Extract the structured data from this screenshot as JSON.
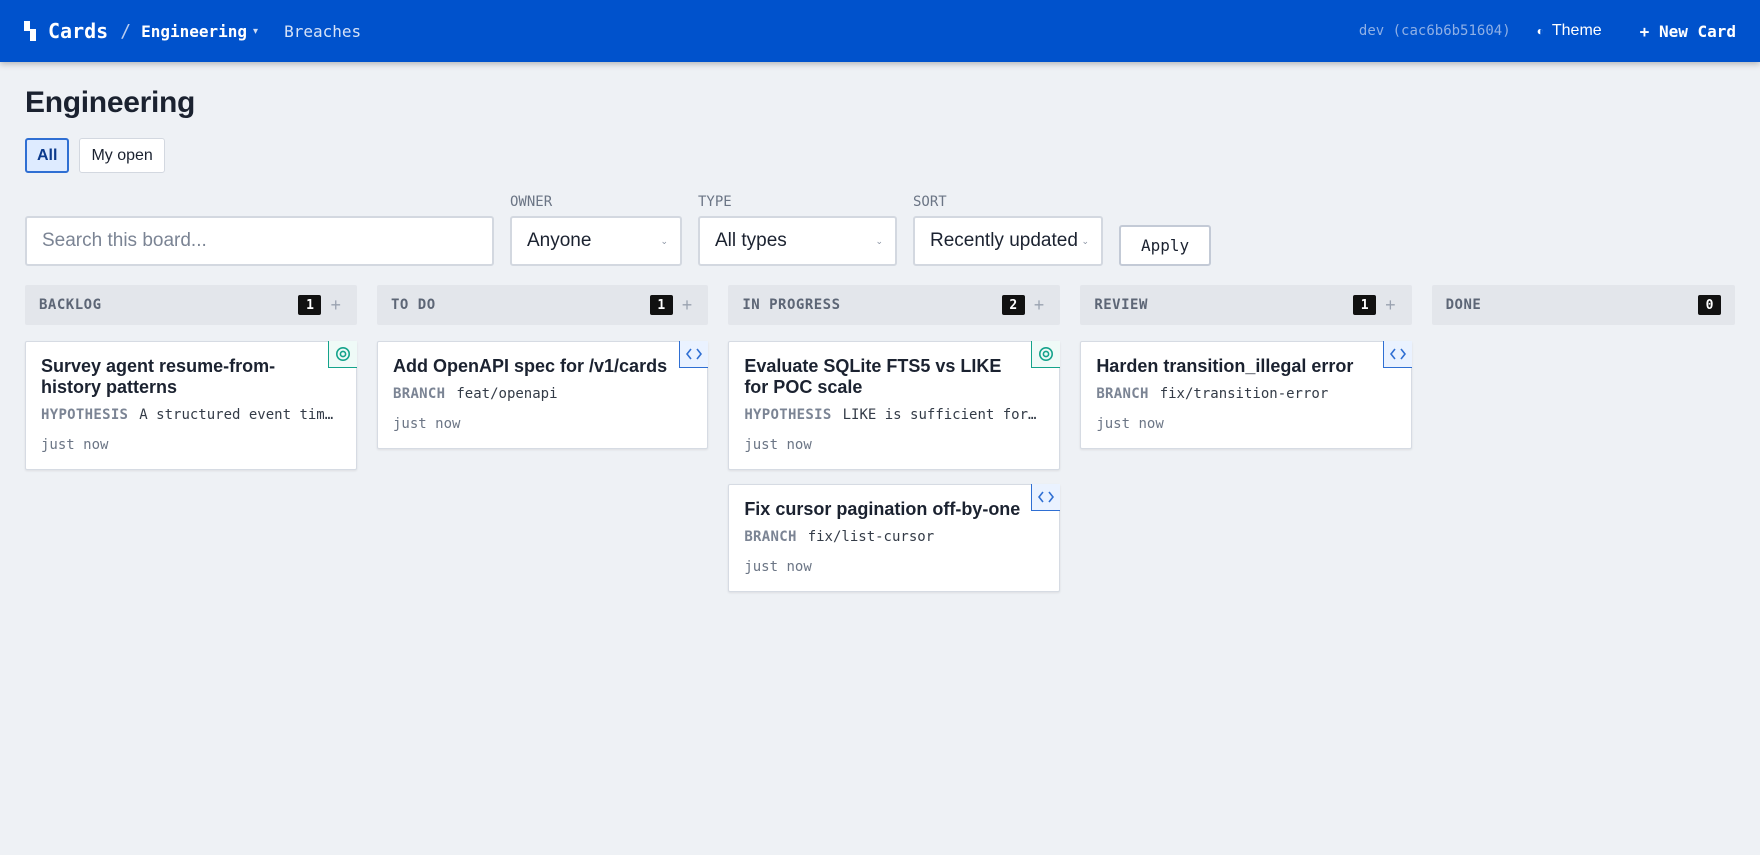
{
  "topbar": {
    "app_name": "Cards",
    "separator": "/",
    "board_name": "Engineering",
    "board_caret": "▾",
    "nav_link": "Breaches",
    "build": "dev (cac6b6b51604)",
    "theme_icon": "◐",
    "theme_label": "Theme",
    "new_card_label": "+ New Card"
  },
  "page": {
    "title": "Engineering",
    "tabs": [
      {
        "label": "All",
        "active": true
      },
      {
        "label": "My open",
        "active": false
      }
    ]
  },
  "filters": {
    "search_placeholder": "Search this board...",
    "owner_label": "OWNER",
    "owner_value": "Anyone",
    "type_label": "TYPE",
    "type_value": "All types",
    "sort_label": "SORT",
    "sort_value": "Recently updated",
    "apply_label": "Apply"
  },
  "colors": {
    "topbar": "#0052cc",
    "hypothesis_badge": "#14a38b",
    "code_badge": "#2f6fd3"
  },
  "columns": [
    {
      "name": "BACKLOG",
      "count": "1",
      "add": "+",
      "cards": [
        {
          "title": "Survey agent resume-from-history patterns",
          "type_icon": "target-icon",
          "meta_key": "HYPOTHESIS",
          "meta_val": "A structured event timeline is enough to resume",
          "time": "just now"
        }
      ]
    },
    {
      "name": "TO DO",
      "count": "1",
      "add": "+",
      "cards": [
        {
          "title": "Add OpenAPI spec for /v1/cards",
          "type_icon": "code-icon",
          "meta_key": "BRANCH",
          "meta_val": "feat/openapi",
          "time": "just now"
        }
      ]
    },
    {
      "name": "IN PROGRESS",
      "count": "2",
      "add": "+",
      "cards": [
        {
          "title": "Evaluate SQLite FTS5 vs LIKE for POC scale",
          "type_icon": "target-icon",
          "meta_key": "HYPOTHESIS",
          "meta_val": "LIKE is sufficient for POC scale",
          "time": "just now"
        },
        {
          "title": "Fix cursor pagination off-by-one",
          "type_icon": "code-icon",
          "meta_key": "BRANCH",
          "meta_val": "fix/list-cursor",
          "time": "just now"
        }
      ]
    },
    {
      "name": "REVIEW",
      "count": "1",
      "add": "+",
      "cards": [
        {
          "title": "Harden transition_illegal error",
          "type_icon": "code-icon",
          "meta_key": "BRANCH",
          "meta_val": "fix/transition-error",
          "time": "just now"
        }
      ]
    },
    {
      "name": "DONE",
      "count": "0",
      "add": "",
      "cards": []
    }
  ]
}
